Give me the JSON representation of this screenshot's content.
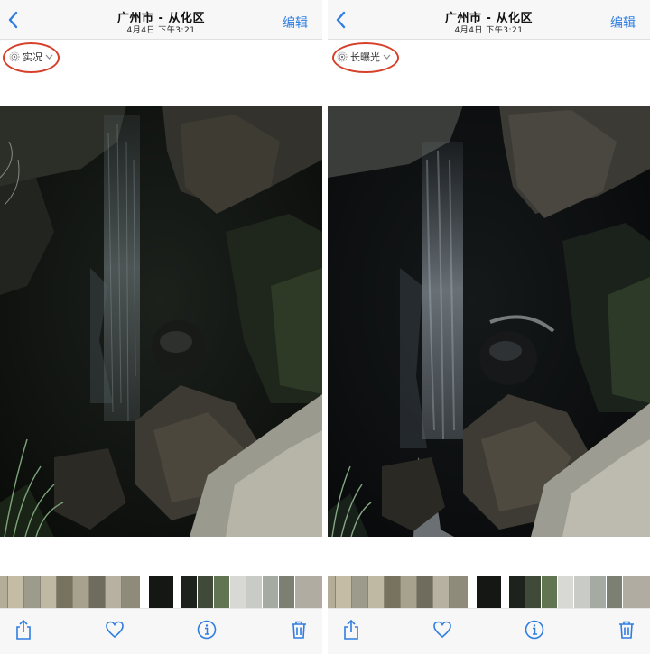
{
  "panels": [
    {
      "nav": {
        "title": "广州市 - 从化区",
        "subtitle": "4月4日  下午3:21",
        "edit_label": "编辑"
      },
      "mode_label": "实况"
    },
    {
      "nav": {
        "title": "广州市 - 从化区",
        "subtitle": "4月4日  下午3:21",
        "edit_label": "编辑"
      },
      "mode_label": "长曝光"
    }
  ],
  "icons": [
    "chevron-left-icon",
    "live-photo-icon",
    "chevron-down-icon",
    "share-icon",
    "heart-icon",
    "info-icon",
    "trash-icon"
  ],
  "colors": {
    "accent": "#2f7de1",
    "annotation_ring": "#d6402b",
    "bar_bg": "#f7f7f8"
  }
}
